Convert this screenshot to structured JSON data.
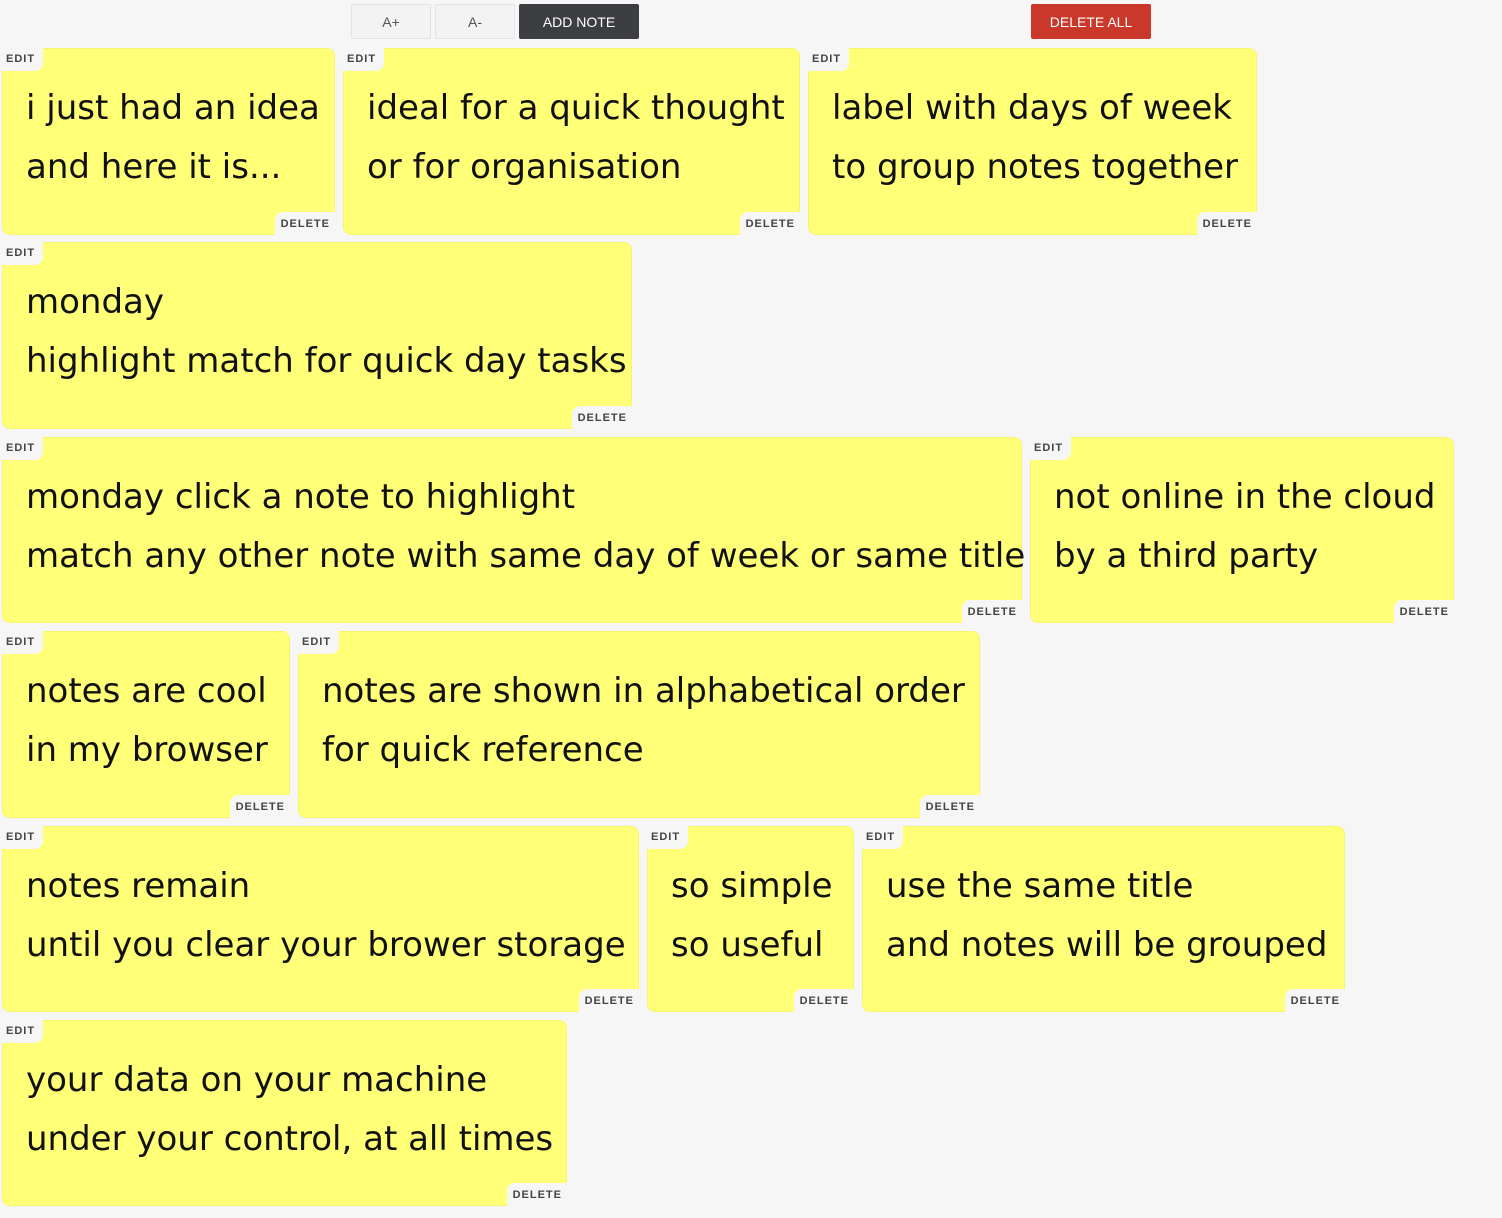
{
  "toolbar": {
    "font_increase_label": "A+",
    "font_decrease_label": "A-",
    "add_note_label": "ADD NOTE",
    "delete_all_label": "DELETE ALL"
  },
  "colors": {
    "note_background": "#ffff78",
    "page_background": "#f6f6f6",
    "add_note_button": "#3d3e42",
    "delete_all_button": "#c9382b"
  },
  "note_labels": {
    "edit": "EDIT",
    "delete": "DELETE"
  },
  "notes": [
    {
      "line1": "i just had an idea",
      "line2": "and here it is..."
    },
    {
      "line1": "ideal for a quick thought",
      "line2": "or for organisation"
    },
    {
      "line1": "label with days of week",
      "line2": "to group notes together"
    },
    {
      "line1": "monday",
      "line2": "highlight match for quick day tasks"
    },
    {
      "line1": "monday click a note to highlight",
      "line2": "match any other note with same day of week or same title"
    },
    {
      "line1": "not online in the cloud",
      "line2": "by a third party"
    },
    {
      "line1": "notes are cool",
      "line2": "in my browser"
    },
    {
      "line1": "notes are shown in alphabetical order",
      "line2": "for quick reference"
    },
    {
      "line1": "notes remain",
      "line2": "until you clear your brower storage"
    },
    {
      "line1": "so simple",
      "line2": "so useful"
    },
    {
      "line1": "use the same title",
      "line2": "and notes will be grouped"
    },
    {
      "line1": "your data on your machine",
      "line2": "under your control, at all times"
    }
  ]
}
